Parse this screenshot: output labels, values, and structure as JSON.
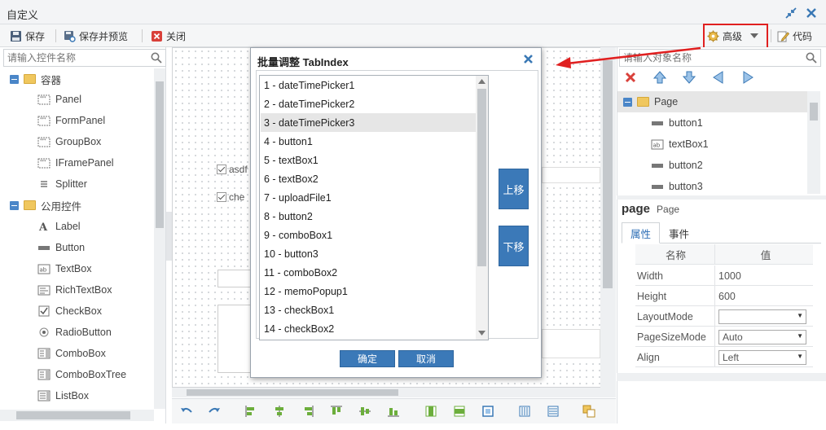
{
  "window": {
    "title": "自定义"
  },
  "toolbar": {
    "save": "保存",
    "save_preview": "保存并预览",
    "close": "关闭",
    "advanced": "高级",
    "code": "代码"
  },
  "left_panel": {
    "search_placeholder": "请输入控件名称",
    "groups": [
      {
        "label": "容器",
        "items": [
          "Panel",
          "FormPanel",
          "GroupBox",
          "IFramePanel",
          "Splitter"
        ]
      },
      {
        "label": "公用控件",
        "items": [
          "Label",
          "Button",
          "TextBox",
          "RichTextBox",
          "CheckBox",
          "RadioButton",
          "ComboBox",
          "ComboBoxTree",
          "ListBox"
        ]
      }
    ]
  },
  "canvas": {
    "checkbox1": "asdf",
    "checkbox2": "che"
  },
  "dialog": {
    "title": "批量调整 TabIndex",
    "items": [
      "1 - dateTimePicker1",
      "2 - dateTimePicker2",
      "3 - dateTimePicker3",
      "4 - button1",
      "5 - textBox1",
      "6 - textBox2",
      "7 - uploadFile1",
      "8 - button2",
      "9 - comboBox1",
      "10 - button3",
      "11 - comboBox2",
      "12 - memoPopup1",
      "13 - checkBox1",
      "14 - checkBox2"
    ],
    "selected_index": 2,
    "move_up": "上移",
    "move_down": "下移",
    "ok": "确定",
    "cancel": "取消"
  },
  "right_panel": {
    "search_placeholder": "请输入对象名称",
    "tree": {
      "root": "Page",
      "children": [
        "button1",
        "textBox1",
        "button2",
        "button3"
      ]
    },
    "object_name": "page",
    "object_type": "Page",
    "tabs": [
      "属性",
      "事件"
    ],
    "grid_headers": [
      "名称",
      "值"
    ],
    "properties": [
      {
        "name": "Width",
        "value": "1000",
        "type": "text"
      },
      {
        "name": "Height",
        "value": "600",
        "type": "text"
      },
      {
        "name": "LayoutMode",
        "value": "",
        "type": "select"
      },
      {
        "name": "PageSizeMode",
        "value": "Auto",
        "type": "select"
      },
      {
        "name": "Align",
        "value": "Left",
        "type": "select"
      }
    ]
  },
  "colors": {
    "accent_blue": "#3b79b8",
    "highlight_red": "#e02020",
    "selection_gray": "#e6e6e6"
  }
}
